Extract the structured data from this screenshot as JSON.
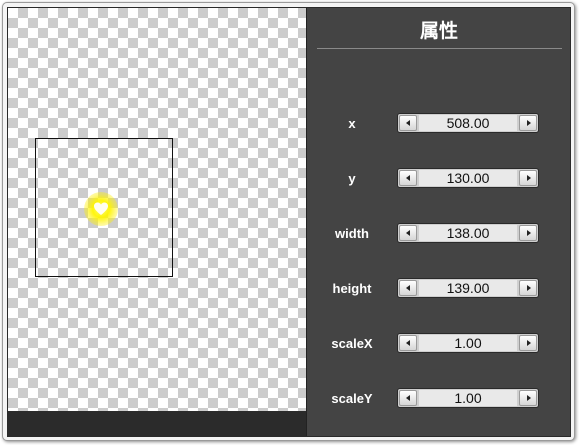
{
  "panel": {
    "title": "属性"
  },
  "properties": [
    {
      "label": "x",
      "value": "508.00"
    },
    {
      "label": "y",
      "value": "130.00"
    },
    {
      "label": "width",
      "value": "138.00"
    },
    {
      "label": "height",
      "value": "139.00"
    },
    {
      "label": "scaleX",
      "value": "1.00"
    },
    {
      "label": "scaleY",
      "value": "1.00"
    }
  ],
  "colors": {
    "panel_bg": "#444444",
    "canvas_checker": "#cccccc",
    "glow": "#fff200"
  },
  "icons": {
    "decrement": "triangle-left-icon",
    "increment": "triangle-right-icon",
    "sprite": "glowing-heart-icon"
  }
}
